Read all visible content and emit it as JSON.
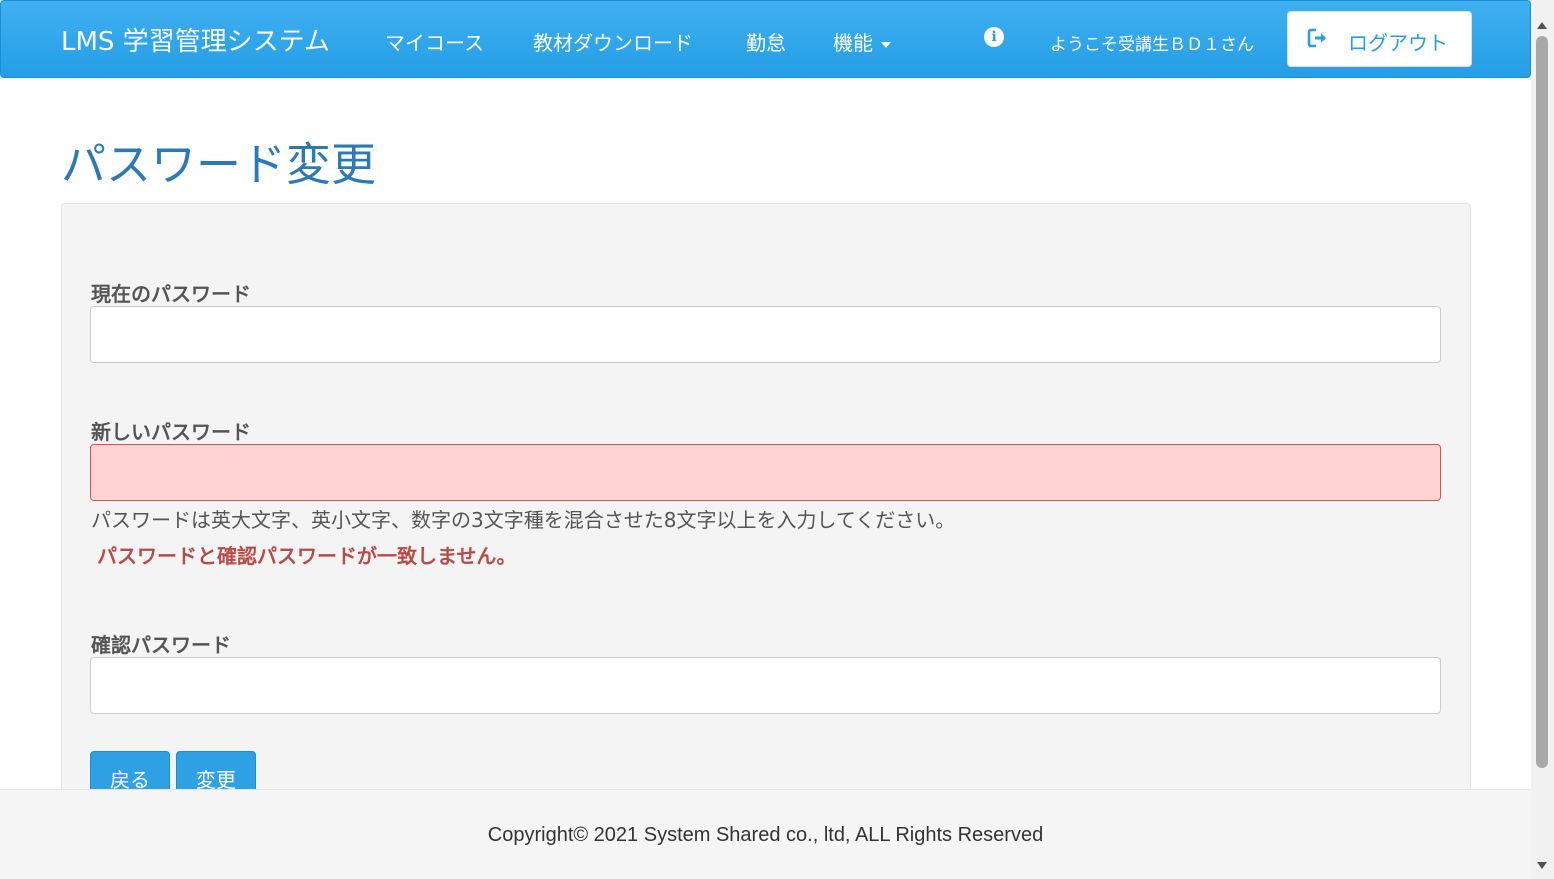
{
  "nav": {
    "brand": "LMS 学習管理システム",
    "items": [
      {
        "label": "マイコース"
      },
      {
        "label": "教材ダウンロード"
      },
      {
        "label": "勤怠"
      },
      {
        "label": "機能"
      }
    ],
    "info_icon": "info-circle-icon",
    "welcome": "ようこそ受講生ＢＤ１さん",
    "logout_label": "ログアウト",
    "logout_icon": "sign-out-icon",
    "bg_color": "#2aa3e9"
  },
  "page": {
    "title": "パスワード変更"
  },
  "form": {
    "current_label": "現在のパスワード",
    "current_value": "",
    "new_label": "新しいパスワード",
    "new_value": "",
    "help": "パスワードは英大文字、英小文字、数字の3文字種を混合させた8文字以上を入力してください。",
    "error": "パスワードと確認パスワードが一致しません。",
    "confirm_label": "確認パスワード",
    "confirm_value": "",
    "back_label": "戻る",
    "submit_label": "変更"
  },
  "footer": {
    "copyright": "Copyright© 2021 System Shared co., ltd, ALL Rights Reserved"
  }
}
